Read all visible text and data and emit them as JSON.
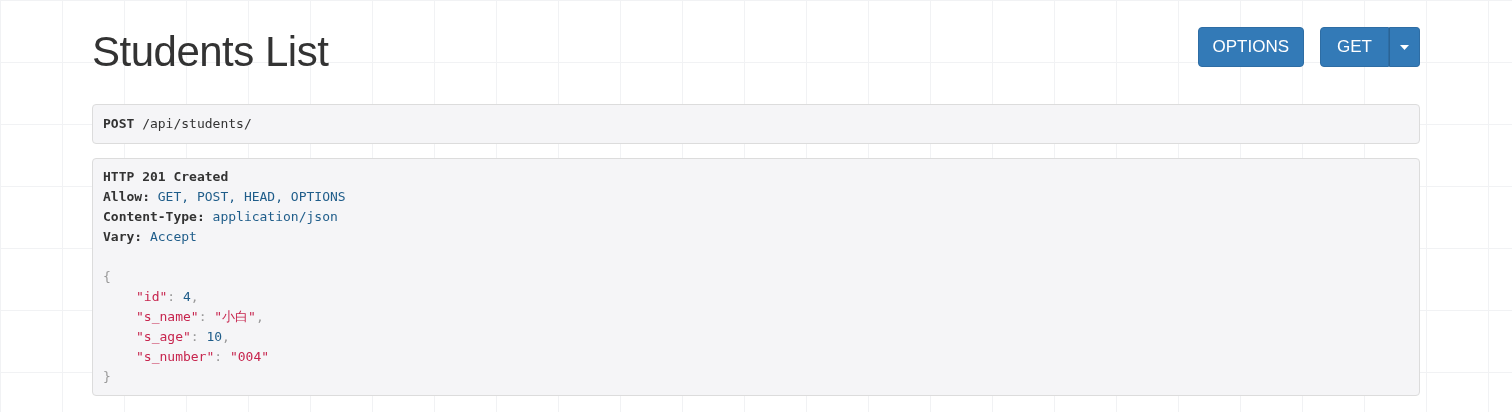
{
  "title": "Students List",
  "buttons": [
    {
      "label": "OPTIONS",
      "kind": "plain"
    },
    {
      "label": "GET",
      "kind": "split"
    }
  ],
  "request": {
    "method": "POST",
    "path": "/api/students/"
  },
  "response": {
    "status": "HTTP 201 Created",
    "headers": [
      {
        "name": "Allow:",
        "value": "GET, POST, HEAD, OPTIONS"
      },
      {
        "name": "Content-Type:",
        "value": "application/json"
      },
      {
        "name": "Vary:",
        "value": "Accept"
      }
    ],
    "open": "{",
    "close": "}",
    "fields": [
      {
        "key": "\"id\"",
        "sep": ":",
        "value": "4",
        "kind": "number",
        "comma": ","
      },
      {
        "key": "\"s_name\"",
        "sep": ":",
        "value": "\"小白\"",
        "kind": "string",
        "comma": ","
      },
      {
        "key": "\"s_age\"",
        "sep": ":",
        "value": "10",
        "kind": "number",
        "comma": ","
      },
      {
        "key": "\"s_number\"",
        "sep": ":",
        "value": "\"004\"",
        "kind": "string"
      }
    ]
  }
}
